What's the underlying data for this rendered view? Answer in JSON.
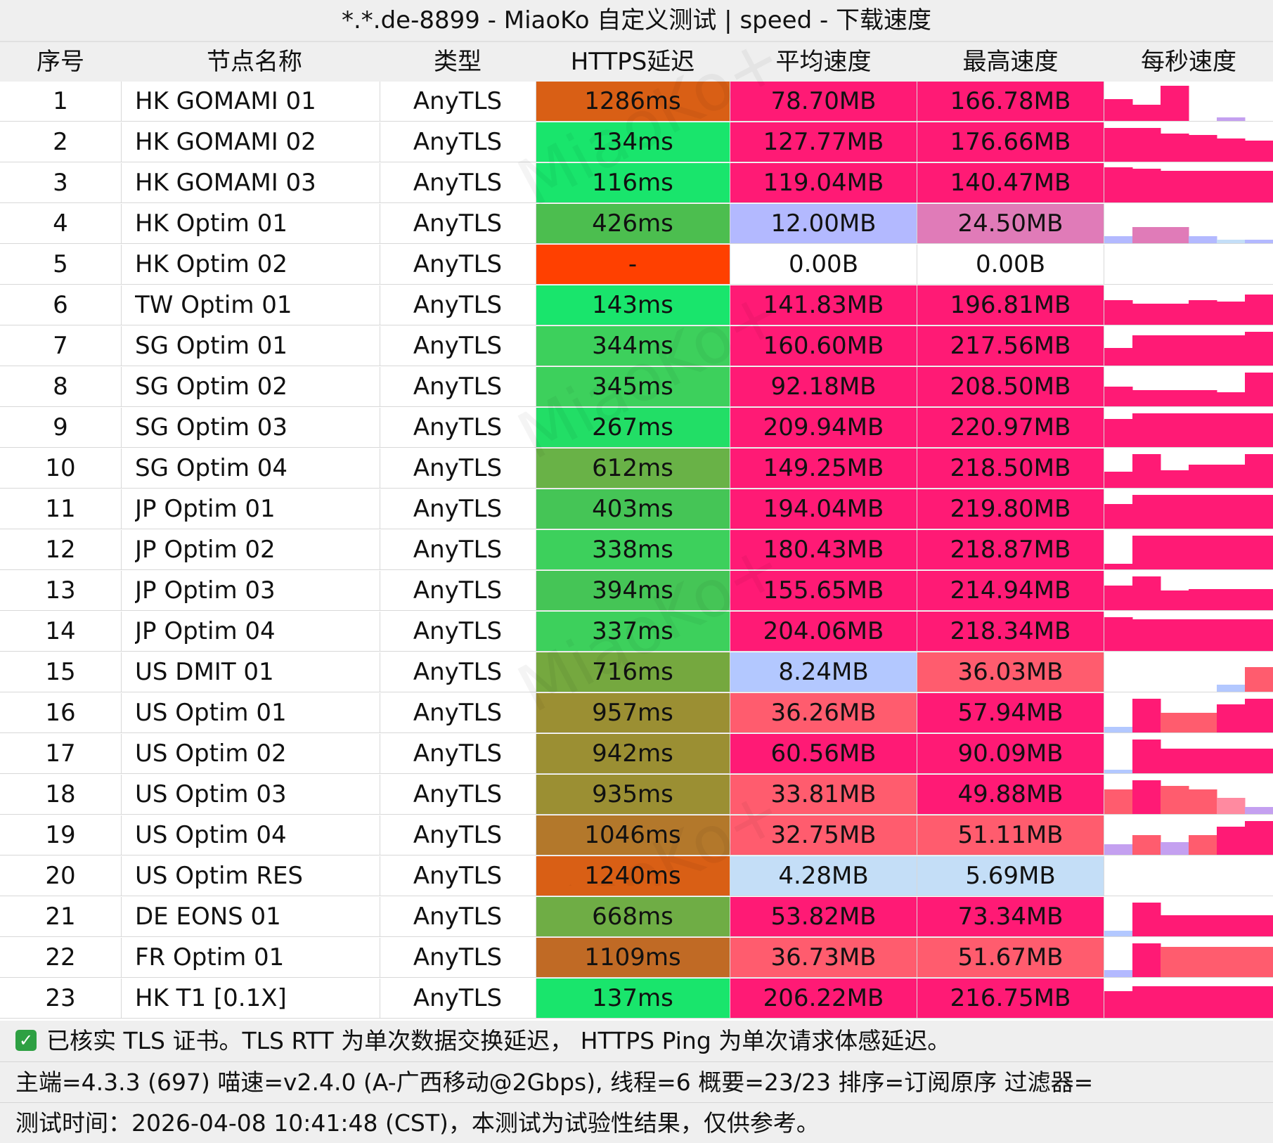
{
  "title": "*.*.de-8899 - MiaoKo 自定义测试 | speed - 下载速度",
  "watermark": "MiaoKo+",
  "headers": [
    "序号",
    "节点名称",
    "类型",
    "HTTPS延迟",
    "平均速度",
    "最高速度",
    "每秒速度"
  ],
  "colors": {
    "green": "#19e56c",
    "pink": "#ff1a75",
    "orange_red": "#ff4000",
    "lavender": "#b3b3ff",
    "light_pink": "#e07bb8",
    "light_blue": "#c4def7",
    "salmon": "#ff5c6e"
  },
  "rows": [
    {
      "idx": "1",
      "name": "HK GOMAMI 01",
      "type": "AnyTLS",
      "latency": "1286ms",
      "avg": "78.70MB",
      "max": "166.78MB",
      "lat_color": "#d95f15",
      "avg_color": "#ff1a75",
      "max_color": "#ff1a75",
      "spark": [
        0.62,
        0.45,
        1.0,
        0.0,
        0.1,
        0.0
      ],
      "spark_colors": [
        "#ff1a75",
        "#ff1a75",
        "#ff1a75",
        "#ff1a75",
        "#c4a0f0",
        "#ff1a75"
      ]
    },
    {
      "idx": "2",
      "name": "HK GOMAMI 02",
      "type": "AnyTLS",
      "latency": "134ms",
      "avg": "127.77MB",
      "max": "176.66MB",
      "lat_color": "#19e56c",
      "avg_color": "#ff1a75",
      "max_color": "#ff1a75",
      "spark": [
        0.95,
        0.95,
        0.8,
        0.75,
        0.65,
        0.6
      ],
      "spark_colors": [
        "#ff1a75",
        "#ff1a75",
        "#ff1a75",
        "#ff1a75",
        "#ff1a75",
        "#ff1a75"
      ]
    },
    {
      "idx": "3",
      "name": "HK GOMAMI 03",
      "type": "AnyTLS",
      "latency": "116ms",
      "avg": "119.04MB",
      "max": "140.47MB",
      "lat_color": "#19e56c",
      "avg_color": "#ff1a75",
      "max_color": "#ff1a75",
      "spark": [
        1.0,
        0.95,
        0.9,
        0.9,
        0.9,
        0.9
      ],
      "spark_colors": [
        "#ff1a75",
        "#ff1a75",
        "#ff1a75",
        "#ff1a75",
        "#ff1a75",
        "#ff1a75"
      ]
    },
    {
      "idx": "4",
      "name": "HK Optim 01",
      "type": "AnyTLS",
      "latency": "426ms",
      "avg": "12.00MB",
      "max": "24.50MB",
      "lat_color": "#4cbe4f",
      "avg_color": "#b3b9ff",
      "max_color": "#e07bb8",
      "spark": [
        0.2,
        0.45,
        0.45,
        0.2,
        0.1,
        0.1
      ],
      "spark_colors": [
        "#b3b9ff",
        "#e07bb8",
        "#e07bb8",
        "#b3b9ff",
        "#c4def7",
        "#b3b9ff"
      ]
    },
    {
      "idx": "5",
      "name": "HK Optim 02",
      "type": "AnyTLS",
      "latency": "-",
      "avg": "0.00B",
      "max": "0.00B",
      "lat_color": "#ff4000",
      "avg_color": "#ffffff",
      "max_color": "#ffffff",
      "spark": [
        0,
        0,
        0,
        0,
        0,
        0
      ],
      "spark_colors": [
        "#ffffff",
        "#ffffff",
        "#ffffff",
        "#ffffff",
        "#ffffff",
        "#ffffff"
      ]
    },
    {
      "idx": "6",
      "name": "TW Optim 01",
      "type": "AnyTLS",
      "latency": "143ms",
      "avg": "141.83MB",
      "max": "196.81MB",
      "lat_color": "#19e56c",
      "avg_color": "#ff1a75",
      "max_color": "#ff1a75",
      "spark": [
        0.7,
        0.6,
        0.6,
        0.7,
        0.65,
        0.85
      ],
      "spark_colors": [
        "#ff1a75",
        "#ff1a75",
        "#ff1a75",
        "#ff1a75",
        "#ff1a75",
        "#ff1a75"
      ]
    },
    {
      "idx": "7",
      "name": "SG Optim 01",
      "type": "AnyTLS",
      "latency": "344ms",
      "avg": "160.60MB",
      "max": "217.56MB",
      "lat_color": "#3dd05c",
      "avg_color": "#ff1a75",
      "max_color": "#ff1a75",
      "spark": [
        0.5,
        0.85,
        0.85,
        0.85,
        0.85,
        0.95
      ],
      "spark_colors": [
        "#ff1a75",
        "#ff1a75",
        "#ff1a75",
        "#ff1a75",
        "#ff1a75",
        "#ff1a75"
      ]
    },
    {
      "idx": "8",
      "name": "SG Optim 02",
      "type": "AnyTLS",
      "latency": "345ms",
      "avg": "92.18MB",
      "max": "208.50MB",
      "lat_color": "#3dd05c",
      "avg_color": "#ff1a75",
      "max_color": "#ff1a75",
      "spark": [
        0.55,
        0.45,
        0.45,
        0.45,
        0.4,
        0.95
      ],
      "spark_colors": [
        "#ff1a75",
        "#ff1a75",
        "#ff1a75",
        "#ff1a75",
        "#ff1a75",
        "#ff1a75"
      ]
    },
    {
      "idx": "9",
      "name": "SG Optim 03",
      "type": "AnyTLS",
      "latency": "267ms",
      "avg": "209.94MB",
      "max": "220.97MB",
      "lat_color": "#22de66",
      "avg_color": "#ff1a75",
      "max_color": "#ff1a75",
      "spark": [
        0.8,
        0.95,
        0.95,
        0.95,
        0.95,
        0.95
      ],
      "spark_colors": [
        "#ff1a75",
        "#ff1a75",
        "#ff1a75",
        "#ff1a75",
        "#ff1a75",
        "#ff1a75"
      ]
    },
    {
      "idx": "10",
      "name": "SG Optim 04",
      "type": "AnyTLS",
      "latency": "612ms",
      "avg": "149.25MB",
      "max": "218.50MB",
      "lat_color": "#69b247",
      "avg_color": "#ff1a75",
      "max_color": "#ff1a75",
      "spark": [
        0.45,
        0.95,
        0.5,
        0.65,
        0.65,
        0.95
      ],
      "spark_colors": [
        "#ff1a75",
        "#ff1a75",
        "#ff1a75",
        "#ff1a75",
        "#ff1a75",
        "#ff1a75"
      ]
    },
    {
      "idx": "11",
      "name": "JP Optim 01",
      "type": "AnyTLS",
      "latency": "403ms",
      "avg": "194.04MB",
      "max": "219.80MB",
      "lat_color": "#45c556",
      "avg_color": "#ff1a75",
      "max_color": "#ff1a75",
      "spark": [
        0.7,
        0.95,
        0.95,
        0.95,
        0.95,
        0.95
      ],
      "spark_colors": [
        "#ff1a75",
        "#ff1a75",
        "#ff1a75",
        "#ff1a75",
        "#ff1a75",
        "#ff1a75"
      ]
    },
    {
      "idx": "12",
      "name": "JP Optim 02",
      "type": "AnyTLS",
      "latency": "338ms",
      "avg": "180.43MB",
      "max": "218.87MB",
      "lat_color": "#3dd05c",
      "avg_color": "#ff1a75",
      "max_color": "#ff1a75",
      "spark": [
        0.15,
        0.95,
        0.95,
        0.95,
        0.95,
        0.95
      ],
      "spark_colors": [
        "#ff1a75",
        "#ff1a75",
        "#ff1a75",
        "#ff1a75",
        "#ff1a75",
        "#ff1a75"
      ]
    },
    {
      "idx": "13",
      "name": "JP Optim 03",
      "type": "AnyTLS",
      "latency": "394ms",
      "avg": "155.65MB",
      "max": "214.94MB",
      "lat_color": "#45c556",
      "avg_color": "#ff1a75",
      "max_color": "#ff1a75",
      "spark": [
        0.7,
        0.95,
        0.55,
        0.6,
        0.6,
        0.6
      ],
      "spark_colors": [
        "#ff1a75",
        "#ff1a75",
        "#ff1a75",
        "#ff1a75",
        "#ff1a75",
        "#ff1a75"
      ]
    },
    {
      "idx": "14",
      "name": "JP Optim 04",
      "type": "AnyTLS",
      "latency": "337ms",
      "avg": "204.06MB",
      "max": "218.34MB",
      "lat_color": "#3dd05c",
      "avg_color": "#ff1a75",
      "max_color": "#ff1a75",
      "spark": [
        0.95,
        0.9,
        0.9,
        0.9,
        0.9,
        0.9
      ],
      "spark_colors": [
        "#ff1a75",
        "#ff1a75",
        "#ff1a75",
        "#ff1a75",
        "#ff1a75",
        "#ff1a75"
      ]
    },
    {
      "idx": "15",
      "name": "US DMIT 01",
      "type": "AnyTLS",
      "latency": "716ms",
      "avg": "8.24MB",
      "max": "36.03MB",
      "lat_color": "#75a83f",
      "avg_color": "#b3c8ff",
      "max_color": "#ff5c6e",
      "spark": [
        0,
        0,
        0,
        0,
        0.2,
        0.7
      ],
      "spark_colors": [
        "#ffffff",
        "#ffffff",
        "#ffffff",
        "#ffffff",
        "#b3c8ff",
        "#ff5c6e"
      ]
    },
    {
      "idx": "16",
      "name": "US Optim 01",
      "type": "AnyTLS",
      "latency": "957ms",
      "avg": "36.26MB",
      "max": "57.94MB",
      "lat_color": "#9b8f33",
      "avg_color": "#ff5c6e",
      "max_color": "#ff1a75",
      "spark": [
        0.15,
        0.95,
        0.55,
        0.55,
        0.8,
        0.95
      ],
      "spark_colors": [
        "#b3c8ff",
        "#ff1a75",
        "#ff5c6e",
        "#ff5c6e",
        "#ff1a75",
        "#ff1a75"
      ]
    },
    {
      "idx": "17",
      "name": "US Optim 02",
      "type": "AnyTLS",
      "latency": "942ms",
      "avg": "60.56MB",
      "max": "90.09MB",
      "lat_color": "#9b8f33",
      "avg_color": "#ff1a75",
      "max_color": "#ff1a75",
      "spark": [
        0.1,
        0.95,
        0.7,
        0.7,
        0.7,
        0.7
      ],
      "spark_colors": [
        "#b3c8ff",
        "#ff1a75",
        "#ff1a75",
        "#ff1a75",
        "#ff1a75",
        "#ff1a75"
      ]
    },
    {
      "idx": "18",
      "name": "US Optim 03",
      "type": "AnyTLS",
      "latency": "935ms",
      "avg": "33.81MB",
      "max": "49.88MB",
      "lat_color": "#9b8f33",
      "avg_color": "#ff5c6e",
      "max_color": "#ff1a75",
      "spark": [
        0.7,
        0.95,
        0.8,
        0.7,
        0.45,
        0.2
      ],
      "spark_colors": [
        "#ff5c6e",
        "#ff1a75",
        "#ff5c6e",
        "#ff5c6e",
        "#ff8aa0",
        "#c4a0f0"
      ]
    },
    {
      "idx": "19",
      "name": "US Optim 04",
      "type": "AnyTLS",
      "latency": "1046ms",
      "avg": "32.75MB",
      "max": "51.11MB",
      "lat_color": "#b3782b",
      "avg_color": "#ff5c6e",
      "max_color": "#ff5c6e",
      "spark": [
        0.3,
        0.55,
        0.35,
        0.55,
        0.8,
        0.95
      ],
      "spark_colors": [
        "#c4a0f0",
        "#ff5c6e",
        "#c4a0f0",
        "#ff5c6e",
        "#ff1a75",
        "#ff1a75"
      ]
    },
    {
      "idx": "20",
      "name": "US Optim RES",
      "type": "AnyTLS",
      "latency": "1240ms",
      "avg": "4.28MB",
      "max": "5.69MB",
      "lat_color": "#d95f15",
      "avg_color": "#c4def7",
      "max_color": "#c4def7",
      "spark": [
        0,
        0,
        0,
        0,
        0,
        0
      ],
      "spark_colors": [
        "#ffffff",
        "#ffffff",
        "#ffffff",
        "#ffffff",
        "#ffffff",
        "#ffffff"
      ]
    },
    {
      "idx": "21",
      "name": "DE EONS 01",
      "type": "AnyTLS",
      "latency": "668ms",
      "avg": "53.82MB",
      "max": "73.34MB",
      "lat_color": "#6fad45",
      "avg_color": "#ff1a75",
      "max_color": "#ff1a75",
      "spark": [
        0.15,
        0.95,
        0.6,
        0.6,
        0.6,
        0.6
      ],
      "spark_colors": [
        "#b3c8ff",
        "#ff1a75",
        "#ff1a75",
        "#ff1a75",
        "#ff1a75",
        "#ff1a75"
      ]
    },
    {
      "idx": "22",
      "name": "FR Optim 01",
      "type": "AnyTLS",
      "latency": "1109ms",
      "avg": "36.73MB",
      "max": "51.67MB",
      "lat_color": "#c06a25",
      "avg_color": "#ff5c6e",
      "max_color": "#ff5c6e",
      "spark": [
        0.2,
        0.95,
        0.85,
        0.85,
        0.85,
        0.85
      ],
      "spark_colors": [
        "#b3b9ff",
        "#ff1a75",
        "#ff5c6e",
        "#ff5c6e",
        "#ff5c6e",
        "#ff5c6e"
      ]
    },
    {
      "idx": "23",
      "name": "HK T1 [0.1X]",
      "type": "AnyTLS",
      "latency": "137ms",
      "avg": "206.22MB",
      "max": "216.75MB",
      "lat_color": "#19e56c",
      "avg_color": "#ff1a75",
      "max_color": "#ff1a75",
      "spark": [
        0.75,
        0.9,
        0.9,
        0.9,
        0.9,
        0.9
      ],
      "spark_colors": [
        "#ff1a75",
        "#ff1a75",
        "#ff1a75",
        "#ff1a75",
        "#ff1a75",
        "#ff1a75"
      ]
    }
  ],
  "footer": {
    "check_icon": "✅",
    "line1": "已核实 TLS 证书。TLS RTT 为单次数据交换延迟， HTTPS Ping 为单次请求体感延迟。",
    "line2": "主端=4.3.3 (697) 喵速=v2.4.0 (A-广西移动@2Gbps), 线程=6 概要=23/23 排序=订阅原序 过滤器=",
    "line3": "测试时间：2026-04-08 10:41:48 (CST)，本测试为试验性结果，仅供参考。"
  }
}
